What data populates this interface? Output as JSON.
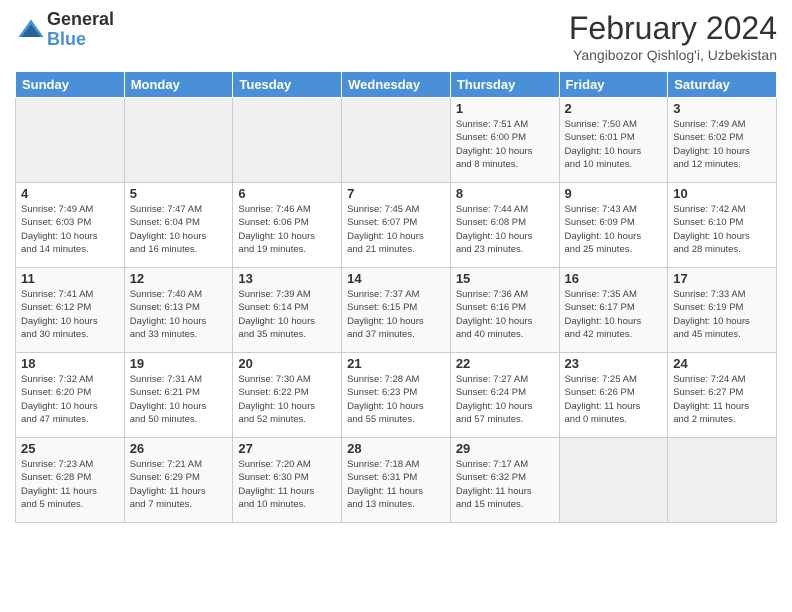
{
  "header": {
    "logo_general": "General",
    "logo_blue": "Blue",
    "title": "February 2024",
    "subtitle": "Yangibozor Qishlog'i, Uzbekistan"
  },
  "weekdays": [
    "Sunday",
    "Monday",
    "Tuesday",
    "Wednesday",
    "Thursday",
    "Friday",
    "Saturday"
  ],
  "weeks": [
    [
      {
        "day": "",
        "info": ""
      },
      {
        "day": "",
        "info": ""
      },
      {
        "day": "",
        "info": ""
      },
      {
        "day": "",
        "info": ""
      },
      {
        "day": "1",
        "info": "Sunrise: 7:51 AM\nSunset: 6:00 PM\nDaylight: 10 hours\nand 8 minutes."
      },
      {
        "day": "2",
        "info": "Sunrise: 7:50 AM\nSunset: 6:01 PM\nDaylight: 10 hours\nand 10 minutes."
      },
      {
        "day": "3",
        "info": "Sunrise: 7:49 AM\nSunset: 6:02 PM\nDaylight: 10 hours\nand 12 minutes."
      }
    ],
    [
      {
        "day": "4",
        "info": "Sunrise: 7:49 AM\nSunset: 6:03 PM\nDaylight: 10 hours\nand 14 minutes."
      },
      {
        "day": "5",
        "info": "Sunrise: 7:47 AM\nSunset: 6:04 PM\nDaylight: 10 hours\nand 16 minutes."
      },
      {
        "day": "6",
        "info": "Sunrise: 7:46 AM\nSunset: 6:06 PM\nDaylight: 10 hours\nand 19 minutes."
      },
      {
        "day": "7",
        "info": "Sunrise: 7:45 AM\nSunset: 6:07 PM\nDaylight: 10 hours\nand 21 minutes."
      },
      {
        "day": "8",
        "info": "Sunrise: 7:44 AM\nSunset: 6:08 PM\nDaylight: 10 hours\nand 23 minutes."
      },
      {
        "day": "9",
        "info": "Sunrise: 7:43 AM\nSunset: 6:09 PM\nDaylight: 10 hours\nand 25 minutes."
      },
      {
        "day": "10",
        "info": "Sunrise: 7:42 AM\nSunset: 6:10 PM\nDaylight: 10 hours\nand 28 minutes."
      }
    ],
    [
      {
        "day": "11",
        "info": "Sunrise: 7:41 AM\nSunset: 6:12 PM\nDaylight: 10 hours\nand 30 minutes."
      },
      {
        "day": "12",
        "info": "Sunrise: 7:40 AM\nSunset: 6:13 PM\nDaylight: 10 hours\nand 33 minutes."
      },
      {
        "day": "13",
        "info": "Sunrise: 7:39 AM\nSunset: 6:14 PM\nDaylight: 10 hours\nand 35 minutes."
      },
      {
        "day": "14",
        "info": "Sunrise: 7:37 AM\nSunset: 6:15 PM\nDaylight: 10 hours\nand 37 minutes."
      },
      {
        "day": "15",
        "info": "Sunrise: 7:36 AM\nSunset: 6:16 PM\nDaylight: 10 hours\nand 40 minutes."
      },
      {
        "day": "16",
        "info": "Sunrise: 7:35 AM\nSunset: 6:17 PM\nDaylight: 10 hours\nand 42 minutes."
      },
      {
        "day": "17",
        "info": "Sunrise: 7:33 AM\nSunset: 6:19 PM\nDaylight: 10 hours\nand 45 minutes."
      }
    ],
    [
      {
        "day": "18",
        "info": "Sunrise: 7:32 AM\nSunset: 6:20 PM\nDaylight: 10 hours\nand 47 minutes."
      },
      {
        "day": "19",
        "info": "Sunrise: 7:31 AM\nSunset: 6:21 PM\nDaylight: 10 hours\nand 50 minutes."
      },
      {
        "day": "20",
        "info": "Sunrise: 7:30 AM\nSunset: 6:22 PM\nDaylight: 10 hours\nand 52 minutes."
      },
      {
        "day": "21",
        "info": "Sunrise: 7:28 AM\nSunset: 6:23 PM\nDaylight: 10 hours\nand 55 minutes."
      },
      {
        "day": "22",
        "info": "Sunrise: 7:27 AM\nSunset: 6:24 PM\nDaylight: 10 hours\nand 57 minutes."
      },
      {
        "day": "23",
        "info": "Sunrise: 7:25 AM\nSunset: 6:26 PM\nDaylight: 11 hours\nand 0 minutes."
      },
      {
        "day": "24",
        "info": "Sunrise: 7:24 AM\nSunset: 6:27 PM\nDaylight: 11 hours\nand 2 minutes."
      }
    ],
    [
      {
        "day": "25",
        "info": "Sunrise: 7:23 AM\nSunset: 6:28 PM\nDaylight: 11 hours\nand 5 minutes."
      },
      {
        "day": "26",
        "info": "Sunrise: 7:21 AM\nSunset: 6:29 PM\nDaylight: 11 hours\nand 7 minutes."
      },
      {
        "day": "27",
        "info": "Sunrise: 7:20 AM\nSunset: 6:30 PM\nDaylight: 11 hours\nand 10 minutes."
      },
      {
        "day": "28",
        "info": "Sunrise: 7:18 AM\nSunset: 6:31 PM\nDaylight: 11 hours\nand 13 minutes."
      },
      {
        "day": "29",
        "info": "Sunrise: 7:17 AM\nSunset: 6:32 PM\nDaylight: 11 hours\nand 15 minutes."
      },
      {
        "day": "",
        "info": ""
      },
      {
        "day": "",
        "info": ""
      }
    ]
  ]
}
